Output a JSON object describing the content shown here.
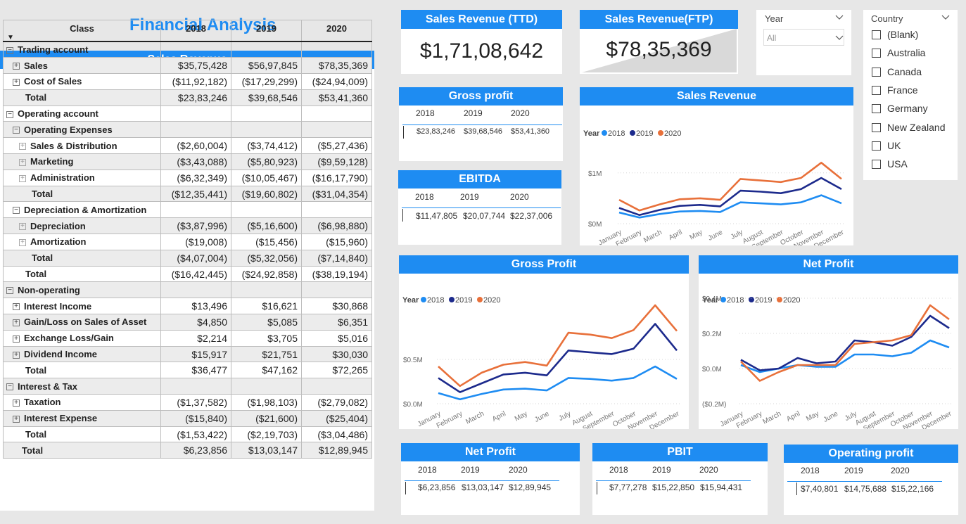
{
  "page_title": "Financial Analysis",
  "table": {
    "header": "Sales Revenue",
    "columns": [
      "Class",
      "2018",
      "2019",
      "2020"
    ],
    "rows": [
      {
        "indent": 0,
        "toggle": "minus",
        "label": "Trading account",
        "v": [
          "",
          "",
          ""
        ]
      },
      {
        "indent": 1,
        "toggle": "plus",
        "label": "Sales",
        "v": [
          "$35,75,428",
          "$56,97,845",
          "$78,35,369"
        ]
      },
      {
        "indent": 1,
        "toggle": "plus",
        "label": "Cost of Sales",
        "v": [
          "($11,92,182)",
          "($17,29,299)",
          "($24,94,009)"
        ]
      },
      {
        "indent": 1,
        "toggle": "none",
        "label": "Total",
        "v": [
          "$23,83,246",
          "$39,68,546",
          "$53,41,360"
        ]
      },
      {
        "indent": 0,
        "toggle": "minus",
        "label": "Operating account",
        "v": [
          "",
          "",
          ""
        ]
      },
      {
        "indent": 1,
        "toggle": "minus",
        "label": "Operating Expenses",
        "v": [
          "",
          "",
          ""
        ]
      },
      {
        "indent": 2,
        "toggle": "plussm",
        "label": "Sales & Distribution",
        "v": [
          "($2,60,004)",
          "($3,74,412)",
          "($5,27,436)"
        ]
      },
      {
        "indent": 2,
        "toggle": "plussm",
        "label": "Marketing",
        "v": [
          "($3,43,088)",
          "($5,80,923)",
          "($9,59,128)"
        ]
      },
      {
        "indent": 2,
        "toggle": "plussm",
        "label": "Administration",
        "v": [
          "($6,32,349)",
          "($10,05,467)",
          "($16,17,790)"
        ]
      },
      {
        "indent": 2,
        "toggle": "none",
        "label": "Total",
        "v": [
          "($12,35,441)",
          "($19,60,802)",
          "($31,04,354)"
        ]
      },
      {
        "indent": 1,
        "toggle": "minus",
        "label": "Depreciation & Amortization",
        "v": [
          "",
          "",
          ""
        ]
      },
      {
        "indent": 2,
        "toggle": "plussm",
        "label": "Depreciation",
        "v": [
          "($3,87,996)",
          "($5,16,600)",
          "($6,98,880)"
        ]
      },
      {
        "indent": 2,
        "toggle": "plussm",
        "label": "Amortization",
        "v": [
          "($19,008)",
          "($15,456)",
          "($15,960)"
        ]
      },
      {
        "indent": 2,
        "toggle": "none",
        "label": "Total",
        "v": [
          "($4,07,004)",
          "($5,32,056)",
          "($7,14,840)"
        ]
      },
      {
        "indent": 1,
        "toggle": "none",
        "label": "Total",
        "v": [
          "($16,42,445)",
          "($24,92,858)",
          "($38,19,194)"
        ]
      },
      {
        "indent": 0,
        "toggle": "minus",
        "label": "Non-operating",
        "v": [
          "",
          "",
          ""
        ]
      },
      {
        "indent": 1,
        "toggle": "plus",
        "label": "Interest Income",
        "v": [
          "$13,496",
          "$16,621",
          "$30,868"
        ]
      },
      {
        "indent": 1,
        "toggle": "plus",
        "label": "Gain/Loss on Sales of Asset",
        "v": [
          "$4,850",
          "$5,085",
          "$6,351"
        ]
      },
      {
        "indent": 1,
        "toggle": "plus",
        "label": "Exchange Loss/Gain",
        "v": [
          "$2,214",
          "$3,705",
          "$5,016"
        ]
      },
      {
        "indent": 1,
        "toggle": "plus",
        "label": "Dividend Income",
        "v": [
          "$15,917",
          "$21,751",
          "$30,030"
        ]
      },
      {
        "indent": 1,
        "toggle": "none",
        "label": "Total",
        "v": [
          "$36,477",
          "$47,162",
          "$72,265"
        ]
      },
      {
        "indent": 0,
        "toggle": "minus",
        "label": "Interest & Tax",
        "v": [
          "",
          "",
          ""
        ]
      },
      {
        "indent": 1,
        "toggle": "plus",
        "label": "Taxation",
        "v": [
          "($1,37,582)",
          "($1,98,103)",
          "($2,79,082)"
        ]
      },
      {
        "indent": 1,
        "toggle": "plus",
        "label": "Interest Expense",
        "v": [
          "($15,840)",
          "($21,600)",
          "($25,404)"
        ]
      },
      {
        "indent": 1,
        "toggle": "none",
        "label": "Total",
        "v": [
          "($1,53,422)",
          "($2,19,703)",
          "($3,04,486)"
        ]
      },
      {
        "indent": 0,
        "toggle": "none",
        "label": "Total",
        "v": [
          "$6,23,856",
          "$13,03,147",
          "$12,89,945"
        ]
      }
    ]
  },
  "kpis": {
    "ttd": {
      "title": "Sales Revenue (TTD)",
      "value": "$1,71,08,642"
    },
    "ftp": {
      "title": "Sales Revenue(FTP)",
      "value": "$78,35,369"
    }
  },
  "year_slicer": {
    "label": "Year",
    "selected": "All"
  },
  "country_slicer": {
    "label": "Country",
    "options": [
      "(Blank)",
      "Australia",
      "Canada",
      "France",
      "Germany",
      "New Zealand",
      "UK",
      "USA"
    ]
  },
  "mini_cards": {
    "gross_profit": {
      "title": "Gross profit",
      "years": [
        "2018",
        "2019",
        "2020"
      ],
      "values": [
        "$23,83,246",
        "$39,68,546",
        "$53,41,360"
      ]
    },
    "ebitda": {
      "title": "EBITDA",
      "years": [
        "2018",
        "2019",
        "2020"
      ],
      "values": [
        "$11,47,805",
        "$20,07,744",
        "$22,37,006"
      ]
    },
    "net_profit": {
      "title": "Net Profit",
      "years": [
        "2018",
        "2019",
        "2020"
      ],
      "values": [
        "$6,23,856",
        "$13,03,147",
        "$12,89,945"
      ]
    },
    "pbit": {
      "title": "PBIT",
      "years": [
        "2018",
        "2019",
        "2020"
      ],
      "values": [
        "$7,77,278",
        "$15,22,850",
        "$15,94,431"
      ]
    },
    "operating_profit": {
      "title": "Operating profit",
      "years": [
        "2018",
        "2019",
        "2020"
      ],
      "values": [
        "$7,40,801",
        "$14,75,688",
        "$15,22,166"
      ]
    }
  },
  "colors": {
    "accent": "#1e8cf2",
    "s2018": "#1e8cf2",
    "s2019": "#1c2a8c",
    "s2020": "#e8703a"
  },
  "chart_data": [
    {
      "id": "sales",
      "type": "line",
      "title": "Sales Revenue",
      "legend_title": "Year",
      "categories": [
        "January",
        "February",
        "March",
        "April",
        "May",
        "June",
        "July",
        "August",
        "September",
        "October",
        "November",
        "December"
      ],
      "yticks": [
        "$1M",
        "$0M"
      ],
      "ylim": [
        0,
        1800000
      ],
      "series": [
        {
          "name": "2018",
          "values": [
            220000,
            120000,
            190000,
            240000,
            250000,
            230000,
            420000,
            400000,
            380000,
            420000,
            560000,
            400000
          ]
        },
        {
          "name": "2019",
          "values": [
            310000,
            170000,
            270000,
            350000,
            370000,
            340000,
            650000,
            630000,
            600000,
            680000,
            900000,
            680000
          ]
        },
        {
          "name": "2020",
          "values": [
            470000,
            260000,
            380000,
            480000,
            500000,
            470000,
            880000,
            850000,
            820000,
            900000,
            1200000,
            880000
          ]
        }
      ]
    },
    {
      "id": "gross",
      "type": "line",
      "title": "Gross Profit",
      "legend_title": "Year",
      "categories": [
        "January",
        "February",
        "March",
        "April",
        "May",
        "June",
        "July",
        "August",
        "September",
        "October",
        "November",
        "December"
      ],
      "yticks": [
        "$0.5M",
        "$0.0M"
      ],
      "ylim": [
        0,
        1150000
      ],
      "series": [
        {
          "name": "2018",
          "values": [
            120000,
            50000,
            110000,
            160000,
            170000,
            150000,
            290000,
            280000,
            260000,
            290000,
            420000,
            280000
          ]
        },
        {
          "name": "2019",
          "values": [
            290000,
            130000,
            230000,
            330000,
            350000,
            320000,
            600000,
            580000,
            560000,
            620000,
            900000,
            600000
          ]
        },
        {
          "name": "2020",
          "values": [
            420000,
            200000,
            350000,
            440000,
            470000,
            430000,
            800000,
            780000,
            740000,
            830000,
            1110000,
            820000
          ]
        }
      ]
    },
    {
      "id": "net",
      "type": "line",
      "title": "Net Profit",
      "legend_title": "Year",
      "categories": [
        "January",
        "February",
        "March",
        "April",
        "May",
        "June",
        "July",
        "August",
        "September",
        "October",
        "November",
        "December"
      ],
      "yticks": [
        "$0.4M",
        "$0.2M",
        "$0.0M",
        "($0.2M)"
      ],
      "ylim": [
        -200000,
        400000
      ],
      "series": [
        {
          "name": "2018",
          "values": [
            20000,
            -20000,
            0,
            20000,
            10000,
            10000,
            80000,
            80000,
            70000,
            90000,
            160000,
            120000
          ]
        },
        {
          "name": "2019",
          "values": [
            50000,
            -10000,
            0,
            60000,
            30000,
            40000,
            160000,
            150000,
            130000,
            180000,
            300000,
            230000
          ]
        },
        {
          "name": "2020",
          "values": [
            40000,
            -70000,
            -20000,
            20000,
            20000,
            20000,
            140000,
            150000,
            160000,
            190000,
            360000,
            280000
          ]
        }
      ]
    }
  ]
}
